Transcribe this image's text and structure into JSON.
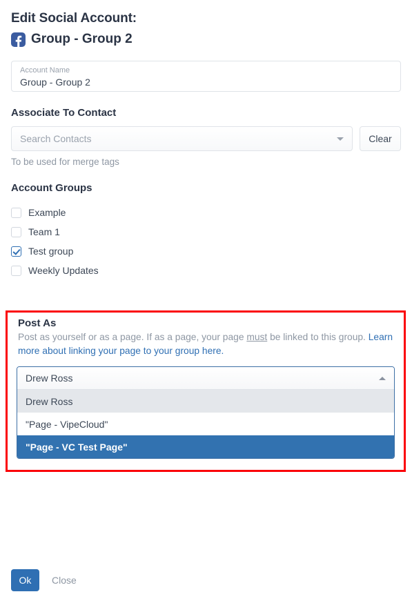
{
  "header": {
    "title": "Edit Social Account:",
    "account_name": "Group - Group 2",
    "network_icon": "facebook-icon"
  },
  "account_name_field": {
    "label": "Account Name",
    "value": "Group - Group 2"
  },
  "associate": {
    "title": "Associate To Contact",
    "search_placeholder": "Search Contacts",
    "clear_label": "Clear",
    "helper": "To be used for merge tags"
  },
  "account_groups": {
    "title": "Account Groups",
    "items": [
      {
        "label": "Example",
        "checked": false
      },
      {
        "label": "Team 1",
        "checked": false
      },
      {
        "label": "Test group",
        "checked": true
      },
      {
        "label": "Weekly Updates",
        "checked": false
      }
    ]
  },
  "post_as": {
    "title": "Post As",
    "desc_part1": "Post as yourself or as a page. If as a page, your page ",
    "desc_emphasis": "must",
    "desc_part2": " be linked to this group. ",
    "desc_link": "Learn more about linking your page to your group here.",
    "selected_value": "Drew Ross",
    "options": [
      {
        "label": "Drew Ross",
        "state": "hover"
      },
      {
        "label": "\"Page - VipeCloud\"",
        "state": "normal"
      },
      {
        "label": "\"Page - VC Test Page\"",
        "state": "selected"
      }
    ]
  },
  "footer": {
    "ok_label": "Ok",
    "close_label": "Close"
  },
  "colors": {
    "accent_blue": "#2f6fb3",
    "highlight_red": "#fb0007",
    "facebook_blue": "#3b5ca0",
    "muted_text": "#8e97a3"
  }
}
